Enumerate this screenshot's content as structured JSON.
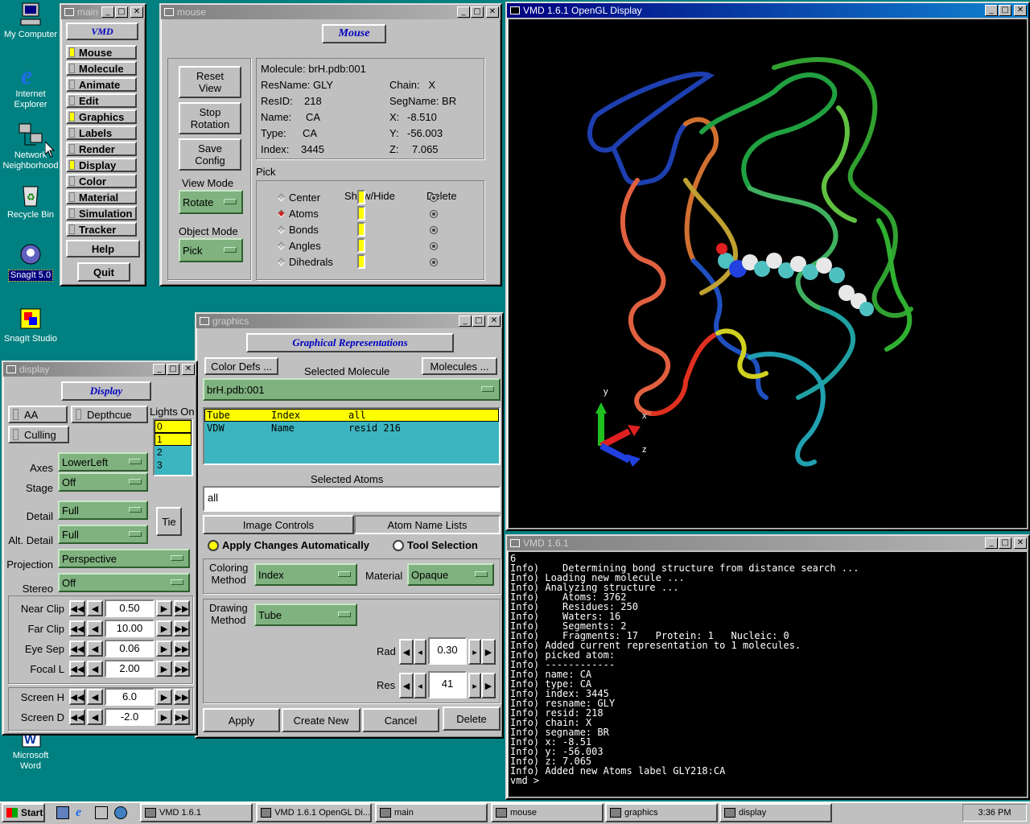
{
  "desktop": {
    "icons": [
      {
        "label_line1": "My Computer",
        "label_line2": ""
      },
      {
        "label_line1": "Internet",
        "label_line2": "Explorer"
      },
      {
        "label_line1": "Network",
        "label_line2": "Neighborhood"
      },
      {
        "label_line1": "Recycle Bin",
        "label_line2": ""
      },
      {
        "label_line1": "SnagIt 5.0",
        "label_line2": ""
      },
      {
        "label_line1": "SnagIt Studio",
        "label_line2": ""
      },
      {
        "label_line1": "Microsoft",
        "label_line2": "Word"
      }
    ]
  },
  "main": {
    "title": "main",
    "header": "VMD",
    "items": [
      "Mouse",
      "Molecule",
      "Animate",
      "Edit",
      "Graphics",
      "Labels",
      "Render",
      "Display",
      "Color",
      "Material",
      "Simulation",
      "Tracker"
    ],
    "active": [
      true,
      false,
      false,
      false,
      true,
      false,
      false,
      true,
      false,
      false,
      false,
      false
    ],
    "help": "Help",
    "quit": "Quit"
  },
  "mouse": {
    "title": "mouse",
    "header": "Mouse",
    "reset_view": [
      "Reset",
      "View"
    ],
    "stop_rotation": [
      "Stop",
      "Rotation"
    ],
    "save_config": [
      "Save",
      "Config"
    ],
    "view_mode_label": "View Mode",
    "view_mode_value": "Rotate",
    "object_mode_label": "Object Mode",
    "object_mode_value": "Pick",
    "info": {
      "molecule": "Molecule: brH.pdb:001",
      "resname": "ResName: GLY",
      "chain": "Chain:   X",
      "resid_l": "ResID:",
      "resid_v": "218",
      "segname": "SegName: BR",
      "name_l": "Name:",
      "name_v": "CA",
      "x_l": "X:",
      "x_v": "-8.510",
      "type_l": "Type:",
      "type_v": "CA",
      "y_l": "Y:",
      "y_v": "-56.003",
      "index_l": "Index:",
      "index_v": "3445",
      "z_l": "Z:",
      "z_v": "7.065"
    },
    "pick_label": "Pick",
    "show_hide": "Show/Hide",
    "delete": "Delete",
    "pick_items": [
      "Center",
      "Atoms",
      "Bonds",
      "Angles",
      "Dihedrals"
    ]
  },
  "opengl": {
    "title": "VMD 1.6.1 OpenGL Display",
    "axis_x": "x",
    "axis_y": "y",
    "axis_z": "z"
  },
  "console": {
    "title": "VMD 1.6.1",
    "lines": [
      "6",
      "Info)    Determining bond structure from distance search ...",
      "Info) Loading new molecule ...",
      "Info) Analyzing structure ...",
      "Info)    Atoms: 3762",
      "Info)    Residues: 250",
      "Info)    Waters: 16",
      "Info)    Segments: 2",
      "Info)    Fragments: 17   Protein: 1   Nucleic: 0",
      "Info) Added current representation to 1 molecules.",
      "Info) picked atom:",
      "Info) ------------",
      "Info) name: CA",
      "Info) type: CA",
      "Info) index: 3445",
      "Info) resname: GLY",
      "Info) resid: 218",
      "Info) chain: X",
      "Info) segname: BR",
      "Info) x: -8.51",
      "Info) y: -56.003",
      "Info) z: 7.065",
      "Info) Added new Atoms label GLY218:CA",
      "",
      "vmd > "
    ]
  },
  "graphics": {
    "title": "graphics",
    "header": "Graphical Representations",
    "color_defs": "Color Defs ...",
    "selected_molecule_label": "Selected Molecule",
    "molecules_btn": "Molecules ...",
    "selected_molecule": "brH.pdb:001",
    "reps": [
      {
        "style": "Tube",
        "color": "Index",
        "sel": "all"
      },
      {
        "style": "VDW",
        "color": "Name",
        "sel": "resid 216"
      }
    ],
    "selected_atoms_label": "Selected Atoms",
    "selected_atoms": "all",
    "tab_image": "Image Controls",
    "tab_atoms": "Atom Name Lists",
    "apply_auto": "Apply Changes Automatically",
    "tool_selection": "Tool Selection",
    "coloring_method_l1": "Coloring",
    "coloring_method_l2": "Method",
    "coloring_value": "Index",
    "material_label": "Material",
    "material_value": "Opaque",
    "drawing_method_l1": "Drawing",
    "drawing_method_l2": "Method",
    "drawing_value": "Tube",
    "rad_label": "Rad",
    "rad_value": "0.30",
    "res_label": "Res",
    "res_value": "41",
    "apply": "Apply",
    "create_new": "Create New",
    "cancel": "Cancel",
    "delete": "Delete"
  },
  "display": {
    "title": "display",
    "header": "Display",
    "aa": "AA",
    "depthcue": "Depthcue",
    "culling": "Culling",
    "lights_label": "Lights On",
    "lights": [
      "0",
      "1",
      "2",
      "3"
    ],
    "axes_label": "Axes",
    "axes_value": "LowerLeft",
    "stage_label": "Stage",
    "stage_value": "Off",
    "detail_label": "Detail",
    "detail_value": "Full",
    "alt_detail_label": "Alt. Detail",
    "alt_detail_value": "Full",
    "tie": "Tie",
    "projection_label": "Projection",
    "projection_value": "Perspective",
    "stereo_label": "Stereo",
    "stereo_value": "Off",
    "near_clip_label": "Near Clip",
    "near_clip_value": "0.50",
    "far_clip_label": "Far Clip",
    "far_clip_value": "10.00",
    "eye_sep_label": "Eye Sep",
    "eye_sep_value": "0.06",
    "focal_label": "Focal L",
    "focal_value": "2.00",
    "screen_h_label": "Screen H",
    "screen_h_value": "6.0",
    "screen_d_label": "Screen D",
    "screen_d_value": "-2.0"
  },
  "taskbar": {
    "start": "Start",
    "tasks": [
      "VMD 1.6.1",
      "VMD 1.6.1 OpenGL Di...",
      "main",
      "mouse",
      "graphics",
      "display"
    ],
    "clock": "3:36 PM"
  }
}
